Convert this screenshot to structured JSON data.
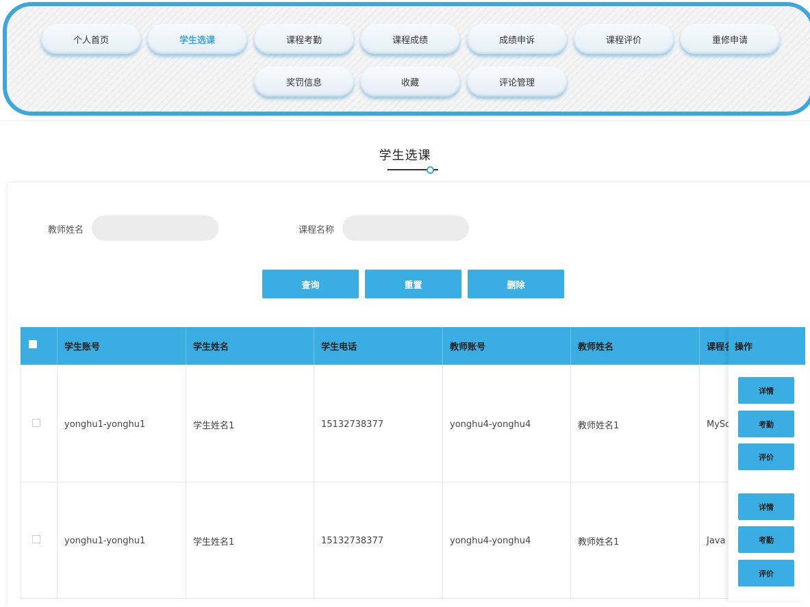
{
  "nav": {
    "row1": [
      "个人首页",
      "学生选课",
      "课程考勤",
      "课程成绩",
      "成绩申诉",
      "课程评价",
      "重修申请"
    ],
    "row2": [
      "奖罚信息",
      "收藏",
      "评论管理"
    ],
    "active": "学生选课"
  },
  "page_title": "学生选课",
  "search": {
    "teacher_label": "教师姓名",
    "teacher_value": "",
    "course_label": "课程名称",
    "course_value": ""
  },
  "buttons": {
    "query": "查询",
    "reset": "重置",
    "delete": "删除"
  },
  "table": {
    "columns": [
      "学生账号",
      "学生姓名",
      "学生电话",
      "教师账号",
      "教师姓名",
      "课程名称"
    ],
    "visible_last_header": "课程名",
    "action_header": "操作",
    "rows": [
      {
        "student_account": "yonghu1-yonghu1",
        "student_name": "学生姓名1",
        "student_phone": "15132738377",
        "teacher_account": "yonghu4-yonghu4",
        "teacher_name": "教师姓名1",
        "course_name": "MySq"
      },
      {
        "student_account": "yonghu1-yonghu1",
        "student_name": "学生姓名1",
        "student_phone": "15132738377",
        "teacher_account": "yonghu4-yonghu4",
        "teacher_name": "教师姓名1",
        "course_name": "Java"
      }
    ],
    "row_actions": [
      "详情",
      "考勤",
      "评价"
    ]
  },
  "colors": {
    "accent": "#3aaee2",
    "nav_border": "#3aa8de",
    "input_bg": "#ececec"
  }
}
